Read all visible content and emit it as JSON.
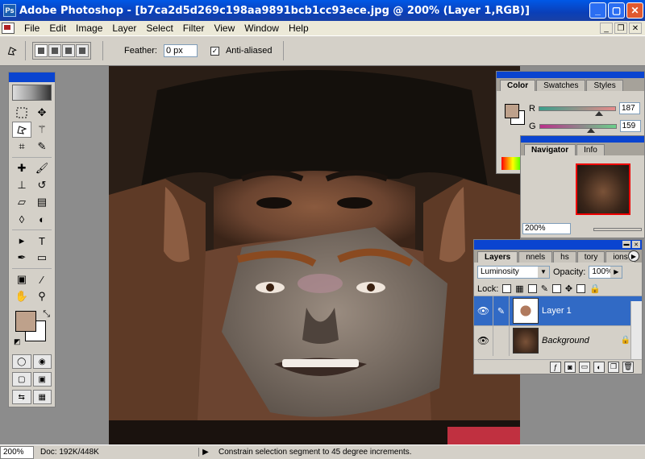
{
  "window": {
    "title": "Adobe Photoshop - [b7ca2d5d269c198aa9891bcb1cc93ece.jpg @ 200% (Layer 1,RGB)]",
    "btn_min": "_",
    "btn_max": "▢",
    "btn_close": "✕"
  },
  "menu": {
    "items": [
      "File",
      "Edit",
      "Image",
      "Layer",
      "Select",
      "Filter",
      "View",
      "Window",
      "Help"
    ],
    "mdi_min": "_",
    "mdi_restore": "❐",
    "mdi_close": "✕"
  },
  "options": {
    "feather_label": "Feather:",
    "feather_value": "0 px",
    "antialias_label": "Anti-aliased",
    "antialias_checked": "✓"
  },
  "panels": {
    "color": {
      "tabs": [
        "Color",
        "Swatches",
        "Styles"
      ],
      "r_label": "R",
      "r_value": "187",
      "g_label": "G",
      "g_value": "159"
    },
    "navigator": {
      "tabs": [
        "Navigator",
        "Info"
      ],
      "zoom": "200%"
    },
    "layers": {
      "tabs": [
        "Layers",
        "nnels",
        "hs",
        "tory",
        "ions"
      ],
      "blend_mode": "Luminosity",
      "opacity_label": "Opacity:",
      "opacity_value": "100%",
      "lock_label": "Lock:",
      "layers": [
        {
          "name": "Layer 1"
        },
        {
          "name": "Background"
        }
      ]
    }
  },
  "status": {
    "zoom": "200%",
    "doc": "Doc: 192K/448K",
    "hint": "Constrain selection segment to 45 degree increments."
  },
  "colors": {
    "foreground": "#bea18b",
    "background": "#ffffff",
    "accent": "#0a44d0",
    "selected_layer": "#316ac5"
  }
}
